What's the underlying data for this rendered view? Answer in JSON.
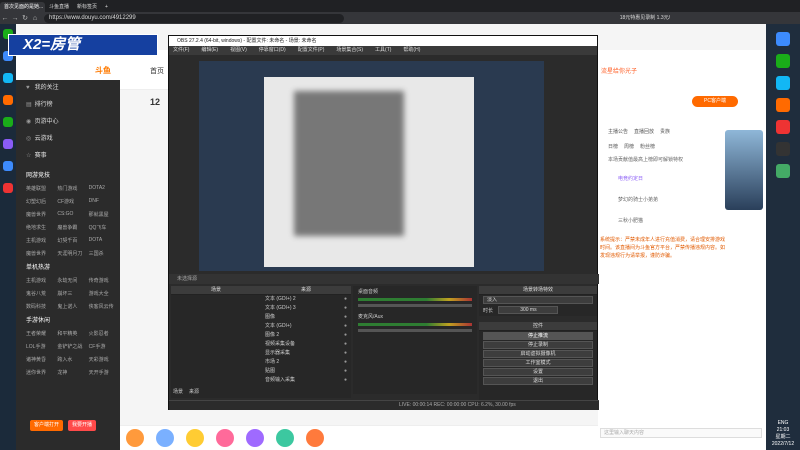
{
  "browser": {
    "tabs": [
      "首次见面的是她...",
      "斗鱼直播",
      "新标签页"
    ],
    "url": "https://www.douyu.com/4912299",
    "tray_text": "18元特惠见录制 1.3元/"
  },
  "streamer_tag": "X2=房管",
  "douyu": {
    "logo": "斗鱼",
    "home": "首页",
    "room_number": "12",
    "nav_main": [
      {
        "icon": "♥",
        "label": "我的关注"
      },
      {
        "icon": "▤",
        "label": "排行榜"
      },
      {
        "icon": "◉",
        "label": "页游中心"
      },
      {
        "icon": "◎",
        "label": "云游戏"
      },
      {
        "icon": "☆",
        "label": "赛事"
      }
    ],
    "nav_sections": [
      {
        "title": "网游竞技",
        "items": [
          "英雄联盟",
          "热门游戏",
          "DOTA2",
          "幻塑幻后",
          "CF游戏",
          "DNF",
          "魔兽世界",
          "CS:GO",
          "那就黑屋",
          "绝地求生",
          "魔兽争霸",
          "QQ飞车",
          "主机游戏",
          "幻契千百",
          "DOTA",
          "魔兽世界",
          "天涯明月刀",
          "三国杀"
        ]
      },
      {
        "title": "单机热游",
        "items": [
          "主机游戏",
          "永劫无间",
          "传奇游戏",
          "鬼谷八荒",
          "崩坏三",
          "游戏大全",
          "数码科技",
          "鬼上诺人",
          "侠客风云传"
        ]
      },
      {
        "title": "手游休闲",
        "items": [
          "王者荣耀",
          "和平精英",
          "火影忍者",
          "LOL手游",
          "金铲铲之战",
          "CF手游",
          "诸神黄昏",
          "跨入水",
          "天彩游戏",
          "迷你世界",
          "龙神",
          "天开手游"
        ]
      }
    ],
    "download_client": "客户端打开",
    "start_stream": "我要开播",
    "pc_client_button": "PC客户端",
    "nick": "流星给你光子"
  },
  "right_panel": {
    "tabs": [
      "主播公告",
      "直播回放",
      "贵族"
    ],
    "sub_tabs": [
      "日榜",
      "周榜",
      "粉丝榜"
    ],
    "promo": "本场贡献值最高上榜即可解锁特权",
    "event": "电竞约定日",
    "users": [
      "梦幻的骑士小弟弟",
      "三秋小肥猫"
    ],
    "notice": "系统提示：严禁未成年人进行充值消费，请合理安排游戏时间。该直播间为斗鱼官方平台，严禁传播违规内容。如发现违规行为请举报，谨防诈骗。",
    "chat_placeholder": "这里输入聊天内容"
  },
  "obs": {
    "title": "OBS 27.2.4 (64-bit, windows) - 配置文件: 未命名 - 场景: 未命名",
    "menu": [
      "文件(F)",
      "编辑(E)",
      "视图(V)",
      "停靠窗口(D)",
      "配置文件(P)",
      "场景集合(S)",
      "工具(T)",
      "帮助(H)"
    ],
    "context_bar": "未选择源",
    "scenes_title": "场景",
    "sources_title": "来源",
    "sources": [
      "文本 (GDI+) 2",
      "文本 (GDI+) 3",
      "图像",
      "文本 (GDI+)",
      "图像 2",
      "视频采集设备",
      "显示器采集",
      "市场 2",
      "贴图",
      "音频输入采集"
    ],
    "mixer_tracks": [
      "桌面音频",
      "麦克风/Aux"
    ],
    "dock_tabs": [
      "场景",
      "来源"
    ],
    "transitions_title": "场景转场特效",
    "transition": "淡入",
    "duration_label": "时长",
    "duration": "300 ms",
    "controls_title": "控件",
    "controls": [
      "停止推流",
      "停止录制",
      "启动虚拟摄像机",
      "工作室模式",
      "设置",
      "退出"
    ],
    "status": "LIVE: 00:00:14  REC: 00:00:00  CPU: 6.2%, 30.00 fps"
  },
  "taskbar": {
    "lang": "ENG",
    "time": "21:03",
    "weekday": "星期二",
    "date": "2022/7/12"
  }
}
